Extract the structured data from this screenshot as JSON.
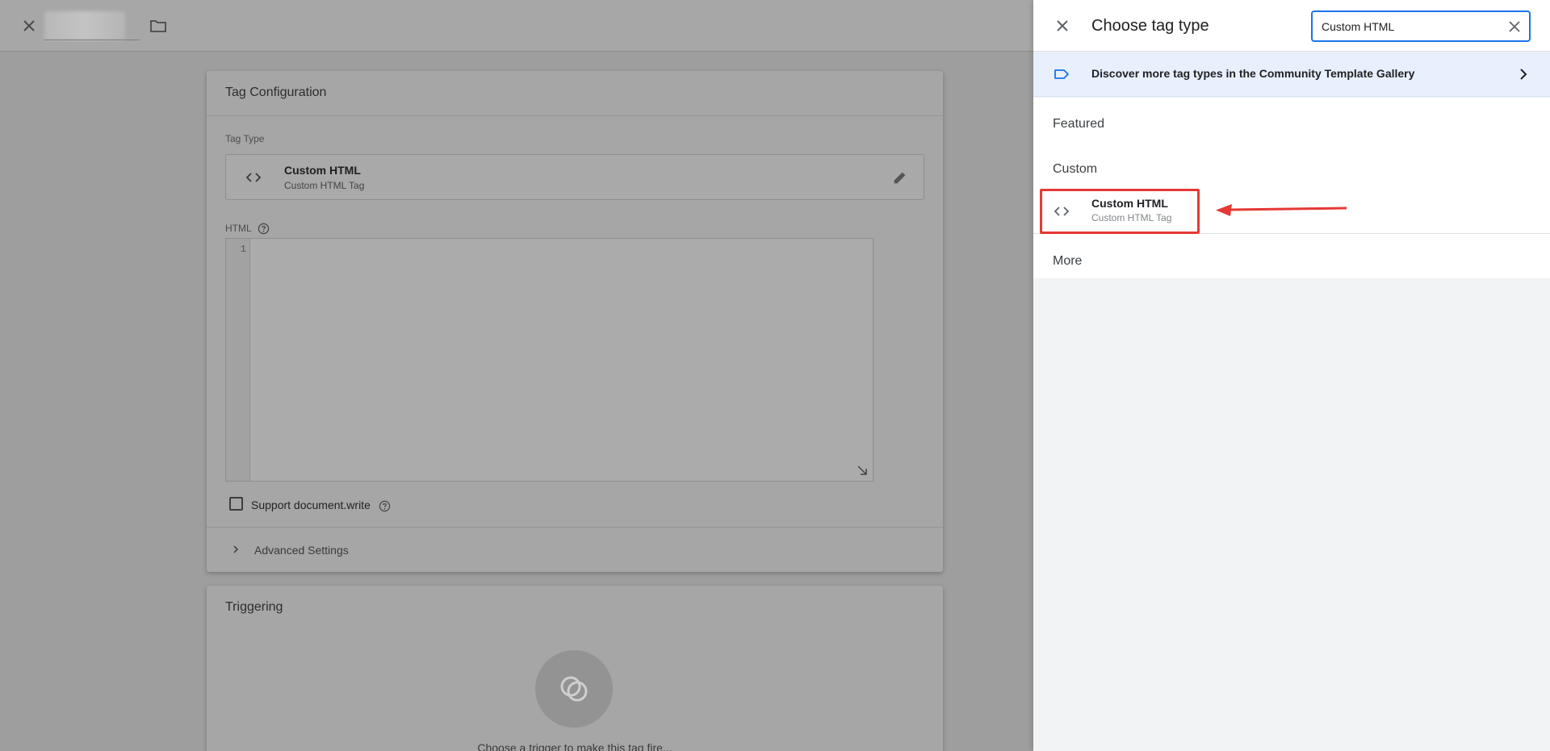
{
  "background": {
    "card_config": {
      "title": "Tag Configuration",
      "tag_type_label": "Tag Type",
      "tag_type_title": "Custom HTML",
      "tag_type_subtitle": "Custom HTML Tag",
      "html_label": "HTML",
      "line_number": "1",
      "support_doc_write": "Support document.write",
      "advanced_settings": "Advanced Settings"
    },
    "card_trigger": {
      "title": "Triggering",
      "hint": "Choose a trigger to make this tag fire..."
    }
  },
  "panel": {
    "title": "Choose tag type",
    "search": {
      "value": "Custom HTML",
      "placeholder": ""
    },
    "discover": "Discover more tag types in the Community Template Gallery",
    "sections": {
      "featured": "Featured",
      "custom": "Custom",
      "more": "More"
    },
    "custom_items": [
      {
        "title": "Custom HTML",
        "subtitle": "Custom HTML Tag",
        "icon": "code-icon"
      }
    ]
  },
  "colors": {
    "accent": "#1a73e8",
    "annotation": "#e53935",
    "discover_bg": "#e8f0fe"
  }
}
